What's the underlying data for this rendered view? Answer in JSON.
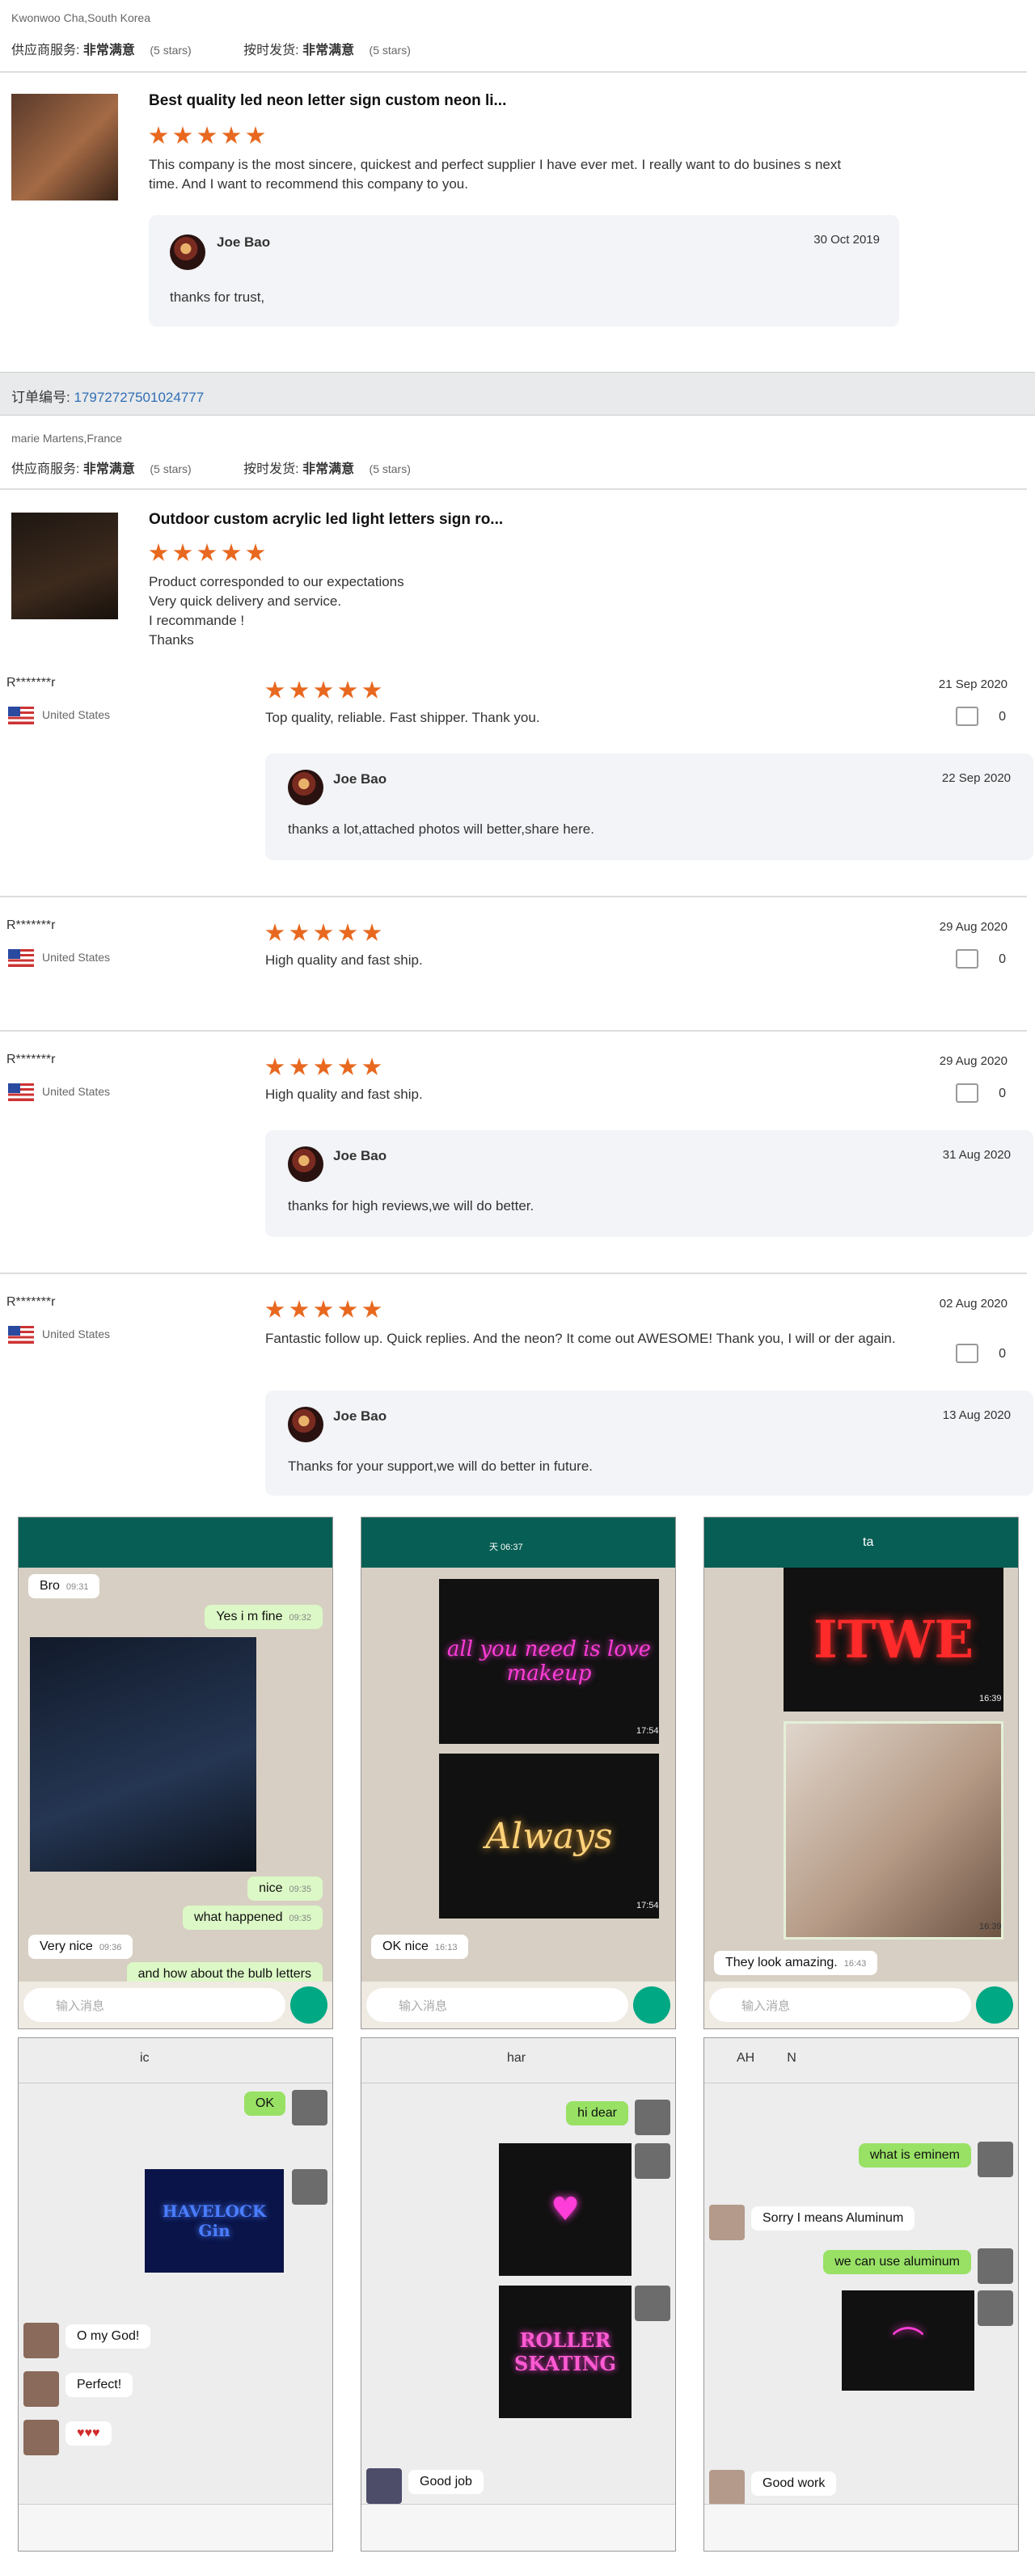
{
  "order1": {
    "buyer": "Kwonwoo Cha,South Korea",
    "service_label": "供应商服务:",
    "service_value": "非常满意",
    "service_stars": "(5 stars)",
    "ship_label": "按时发货:",
    "ship_value": "非常满意",
    "ship_stars": "(5 stars)",
    "product_title": "Best quality led neon letter sign custom neon li...",
    "review": "This company is the most sincere, quickest and perfect supplier I have ever met. I really want to do busines s next time. And I want to recommend this company to you.",
    "reply_name": "Joe Bao",
    "reply_date": "30 Oct 2019",
    "reply_text": "thanks for trust,"
  },
  "order2": {
    "order_label": "订单编号:",
    "order_no": "17972727501024777",
    "buyer": "marie Martens,France",
    "service_label": "供应商服务:",
    "service_value": "非常满意",
    "service_stars": "(5 stars)",
    "ship_label": "按时发货:",
    "ship_value": "非常满意",
    "ship_stars": "(5 stars)",
    "product_title": "Outdoor custom acrylic led light letters sign ro...",
    "review_lines": [
      "Product corresponded to our expectations",
      "Very quick delivery and service.",
      "I recommande !",
      "Thanks"
    ]
  },
  "reviews": [
    {
      "user": "R*******r",
      "country": "United States",
      "date": "21 Sep 2020",
      "text": "Top quality, reliable. Fast shipper. Thank you.",
      "likes": "0",
      "reply_name": "Joe Bao",
      "reply_date": "22 Sep 2020",
      "reply_text": "thanks a lot,attached photos will better,share  here."
    },
    {
      "user": "R*******r",
      "country": "United States",
      "date": "29 Aug 2020",
      "text": "High quality and fast ship.",
      "likes": "0"
    },
    {
      "user": "R*******r",
      "country": "United States",
      "date": "29 Aug 2020",
      "text": "High quality and fast ship.",
      "likes": "0",
      "reply_name": "Joe Bao",
      "reply_date": "31 Aug 2020",
      "reply_text": "thanks for high reviews,we will do better."
    },
    {
      "user": "R*******r",
      "country": "United States",
      "date": "02 Aug 2020",
      "text": "Fantastic follow up. Quick replies. And the neon? It come out AWESOME! Thank you, I will or der again.",
      "likes": "0",
      "reply_name": "Joe Bao",
      "reply_date": "13 Aug 2020",
      "reply_text": "Thanks for your support,we will do better in future."
    }
  ],
  "chat1": {
    "msgs": [
      "Bro",
      "Yes i m fine",
      "nice",
      "what happened",
      "Very nice",
      "and how about the bulb letters"
    ],
    "times": [
      "09:31",
      "09:32",
      "09:35",
      "09:35",
      "09:36"
    ],
    "input_placeholder": "输入消息"
  },
  "chat2": {
    "header_time": "天 06:37",
    "neon1": "all you need is love makeup",
    "neon2": "Always",
    "times": [
      "17:54",
      "17:54",
      "16:13"
    ],
    "msg": "OK nice",
    "input_placeholder": "输入消息"
  },
  "chat3": {
    "header_name": "ta",
    "neon1": "ITWE",
    "times": [
      "16:39",
      "16:39",
      "16:43"
    ],
    "msg": "They look amazing.",
    "input_placeholder": "输入消息"
  },
  "chat4": {
    "header_name": "ic",
    "msgs": [
      "OK",
      "O my God!",
      "Perfect!",
      "♥♥♥"
    ],
    "neon": "HAVELOCK Gin"
  },
  "chat5": {
    "header_name": "har",
    "msgs": [
      "hi dear",
      "Good job"
    ],
    "neon": "ROLLER SKATING"
  },
  "chat6": {
    "header_name": "AH         N",
    "msgs": [
      "what is eminem",
      "Sorry I means Aluminum",
      "we can use aluminum",
      "Good work"
    ]
  },
  "colors": {
    "star": "#e8681f",
    "whatsapp": "#075e54",
    "mic": "#00a884",
    "bubble_green": "#dcf8c6",
    "wechat_green": "#98e165",
    "order_link": "#2f6fb5"
  }
}
